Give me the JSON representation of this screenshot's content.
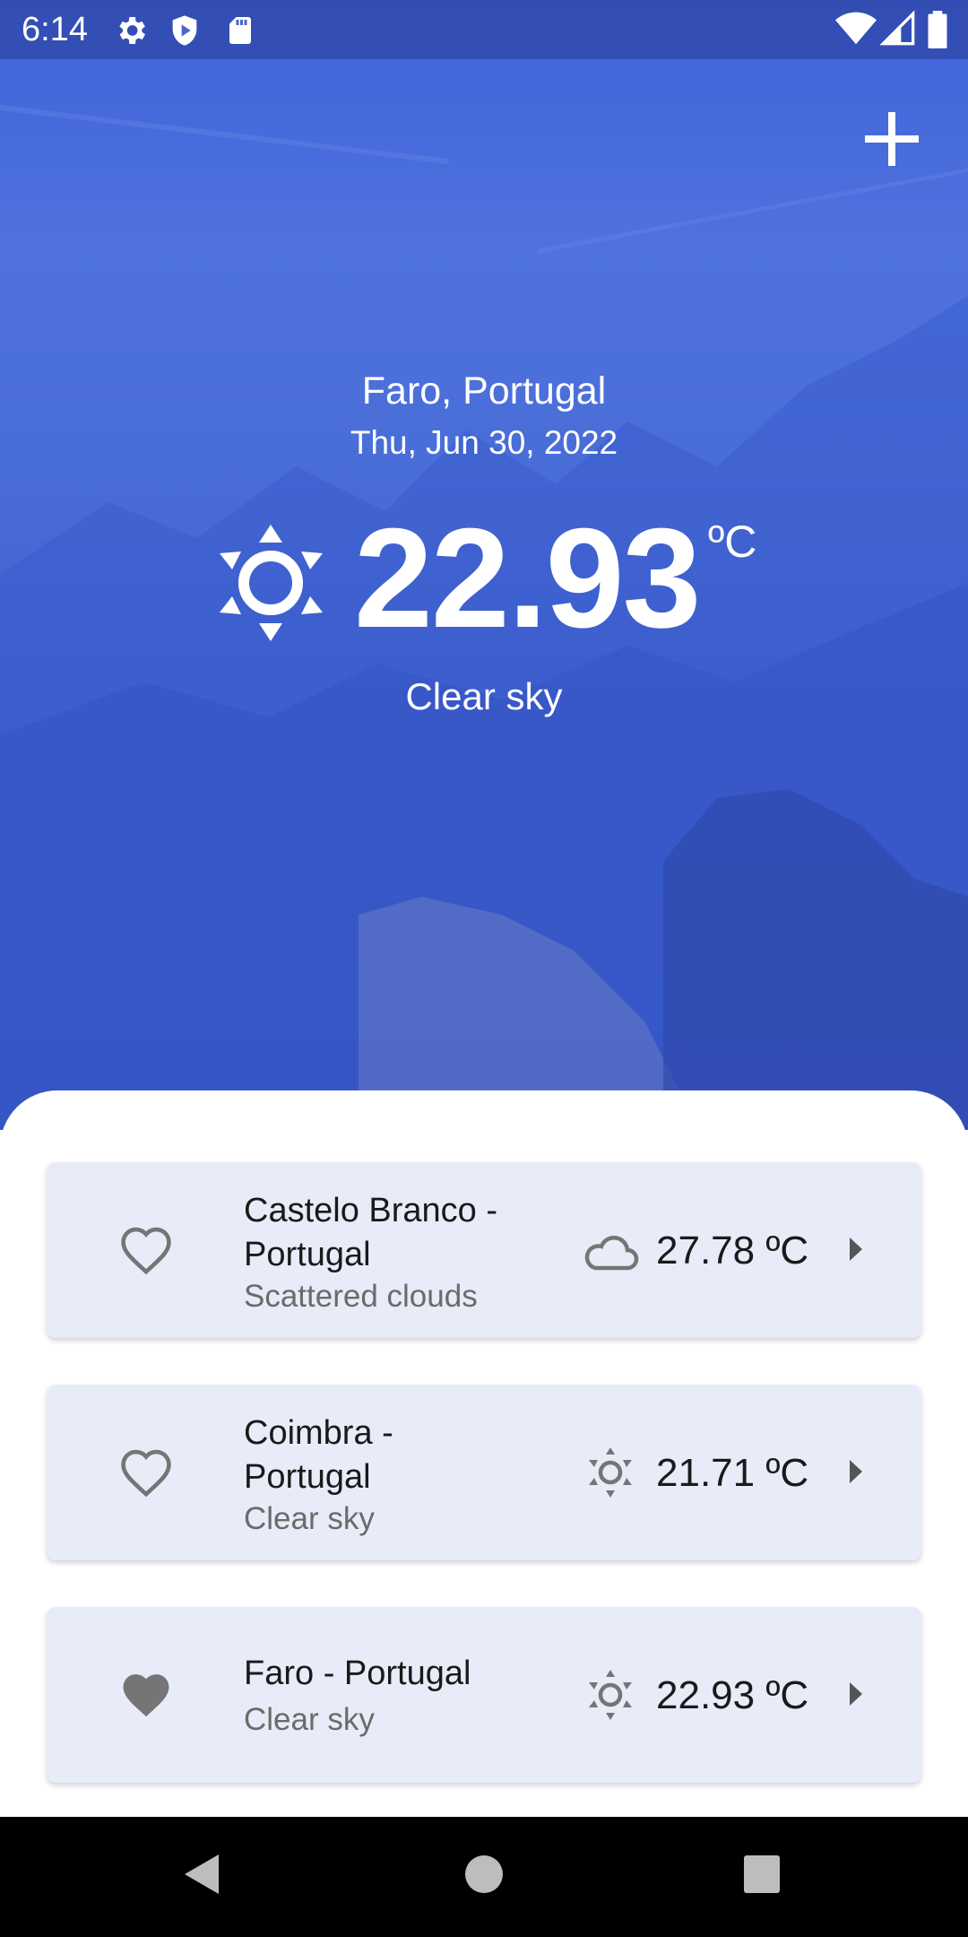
{
  "status_bar": {
    "time": "6:14",
    "left_icons": [
      "gear-icon",
      "shield-play-icon",
      "sd-card-icon"
    ],
    "right_icons": [
      "wifi-icon",
      "signal-icon",
      "battery-icon"
    ]
  },
  "header": {
    "add_icon": "plus-icon"
  },
  "current": {
    "location": "Faro, Portugal",
    "date": "Thu, Jun 30, 2022",
    "temperature": "22.93",
    "unit": "ºC",
    "condition": "Clear sky",
    "icon": "sun-icon"
  },
  "cities": [
    {
      "name": "Castelo Branco - Portugal",
      "line1": "Castelo Branco -",
      "line2": "Portugal",
      "description": "Scattered clouds",
      "temperature": "27.78 ºC",
      "icon": "cloud-icon",
      "favorite": false
    },
    {
      "name": "Coimbra - Portugal",
      "line1": "Coimbra -",
      "line2": "Portugal",
      "description": "Clear sky",
      "temperature": "21.71 ºC",
      "icon": "sun-icon",
      "favorite": false
    },
    {
      "name": "Faro - Portugal",
      "line1": "Faro - Portugal",
      "line2": "",
      "description": "Clear sky",
      "temperature": "22.93 ºC",
      "icon": "sun-icon",
      "favorite": true
    }
  ],
  "colors": {
    "hero_blue": "#4a6ed8",
    "card_bg": "#e8ecf8",
    "icon_gray": "#757575"
  },
  "nav_bar": {
    "buttons": [
      "back-icon",
      "home-icon",
      "recents-icon"
    ]
  }
}
